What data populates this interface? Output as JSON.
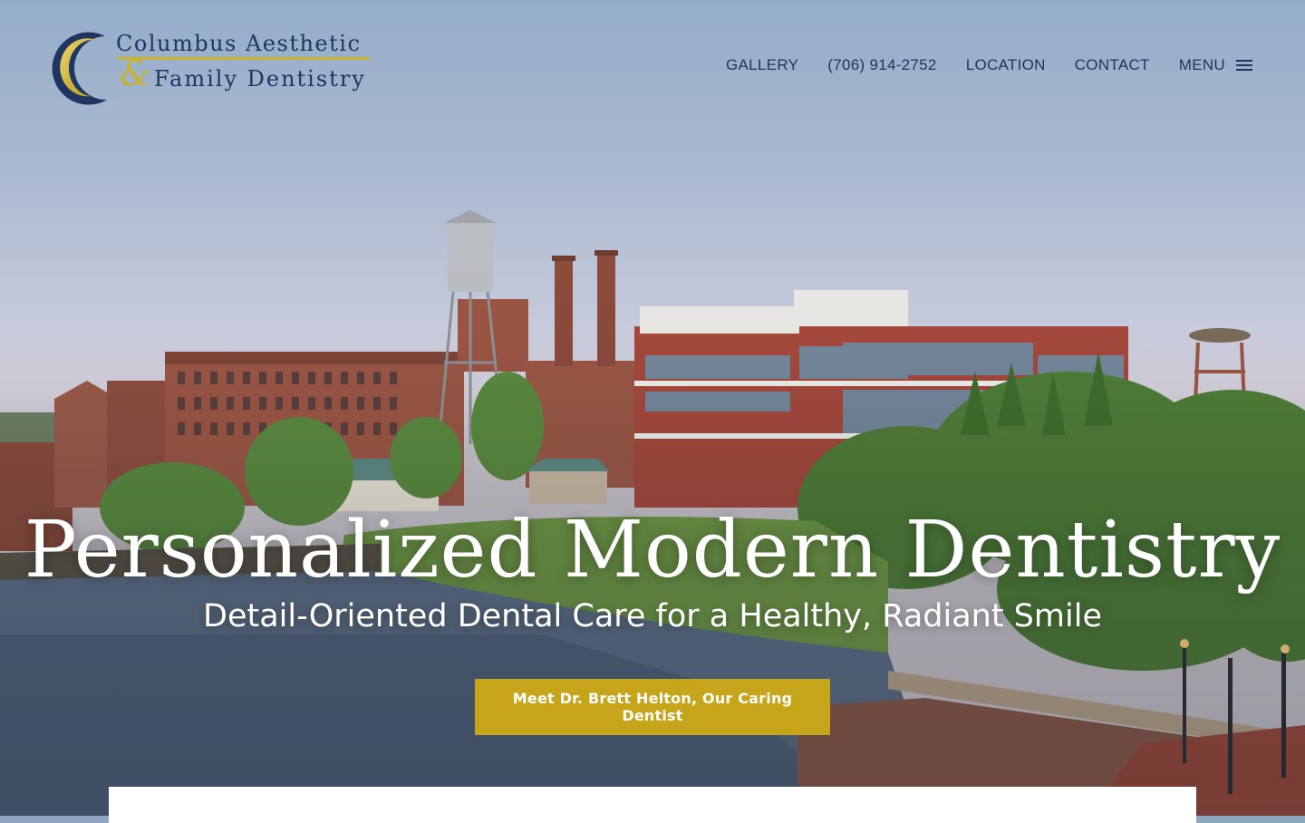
{
  "brand": {
    "line1": "Columbus Aesthetic",
    "ampersand": "&",
    "line2": "Family Dentistry",
    "colors": {
      "navy": "#1f3660",
      "gold": "#c9b328"
    }
  },
  "nav": {
    "items": [
      {
        "label": "GALLERY"
      },
      {
        "label": "(706) 914-2752"
      },
      {
        "label": "LOCATION"
      },
      {
        "label": "CONTACT"
      }
    ],
    "menu_label": "MENU",
    "menu_icon": "hamburger-icon"
  },
  "hero": {
    "title": "Personalized Modern Dentistry",
    "subtitle": "Detail-Oriented Dental Care for a Healthy, Radiant Smile",
    "cta_label": "Meet Dr. Brett Helton, Our Caring Dentist",
    "cta_color": "#c6a51a"
  }
}
